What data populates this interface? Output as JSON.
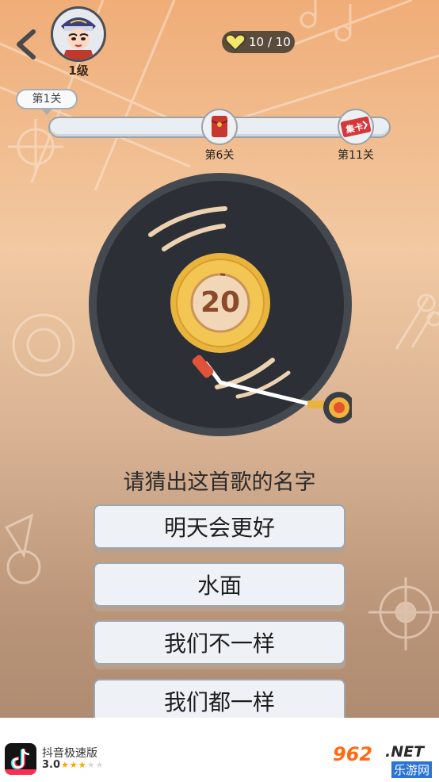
{
  "header": {
    "back_icon": "chevron-left-icon",
    "avatar_icon": "opera-character-avatar",
    "level_label": "1级",
    "hearts_icon": "heart-icon",
    "hearts_text": "10 / 10"
  },
  "progress": {
    "current_stage_label": "第1关",
    "milestones": [
      {
        "label": "第6关",
        "icon": "red-envelope-icon"
      },
      {
        "label": "第11关",
        "icon": "collect-card-icon",
        "badge_text": "集卡"
      }
    ]
  },
  "record": {
    "countdown": "20"
  },
  "question": {
    "prompt": "请猜出这首歌的名字",
    "options": [
      "明天会更好",
      "水面",
      "我们不一样",
      "我们都一样"
    ]
  },
  "ad": {
    "app_name": "抖音极速版",
    "rating": "3.0",
    "stars_filled": 3,
    "stars_total": 5,
    "icon": "douyin-lite-icon"
  },
  "watermark": {
    "number": "962",
    "net": ".NET",
    "site": "乐游网"
  },
  "colors": {
    "background_top": "#f0ad78",
    "background_bottom": "#a9866d",
    "record_body": "#2c3036",
    "record_label": "#e9b43e",
    "button_face": "#eef2f6"
  }
}
